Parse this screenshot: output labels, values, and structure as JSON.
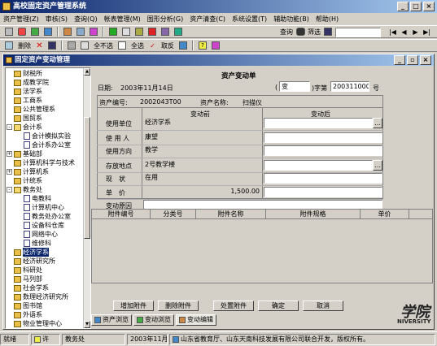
{
  "app": {
    "title": "高校固定资产管理系统"
  },
  "menu": [
    "资产管理(Z)",
    "审核(S)",
    "查询(Q)",
    "帐表管理(M)",
    "图形分析(G)",
    "资产清查(C)",
    "系统设置(T)",
    "辅助功能(B)",
    "帮助(H)"
  ],
  "toolbar2": {
    "delete": "删除",
    "select_none": "全不选",
    "select_all": "全选",
    "cancel_sel": "取反"
  },
  "toolbar1": {
    "query": "查询",
    "filter": "筛选",
    "search_placeholder": ""
  },
  "inner": {
    "title": "固定资产变动管理"
  },
  "tree": [
    {
      "label": "财税所",
      "level": 1,
      "icon": "folder"
    },
    {
      "label": "成教学院",
      "level": 1,
      "icon": "folder"
    },
    {
      "label": "法学系",
      "level": 1,
      "icon": "folder"
    },
    {
      "label": "工商系",
      "level": 1,
      "icon": "folder"
    },
    {
      "label": "公共管理系",
      "level": 1,
      "icon": "folder"
    },
    {
      "label": "国贸系",
      "level": 1,
      "icon": "folder"
    },
    {
      "label": "会计系",
      "level": 1,
      "icon": "folder-open",
      "pm": "-"
    },
    {
      "label": "会计模拟实验",
      "level": 2,
      "icon": "doc"
    },
    {
      "label": "会计系办公室",
      "level": 2,
      "icon": "doc"
    },
    {
      "label": "基础部",
      "level": 1,
      "icon": "folder",
      "pm": "+"
    },
    {
      "label": "计算机科学与技术",
      "level": 1,
      "icon": "folder"
    },
    {
      "label": "计算机系",
      "level": 1,
      "icon": "folder",
      "pm": "+"
    },
    {
      "label": "计统系",
      "level": 1,
      "icon": "folder"
    },
    {
      "label": "教务处",
      "level": 1,
      "icon": "folder-open",
      "pm": "-"
    },
    {
      "label": "电教科",
      "level": 2,
      "icon": "doc"
    },
    {
      "label": "计算机中心",
      "level": 2,
      "icon": "doc"
    },
    {
      "label": "教务处办公室",
      "level": 2,
      "icon": "doc"
    },
    {
      "label": "设备科仓库",
      "level": 2,
      "icon": "doc"
    },
    {
      "label": "网络中心",
      "level": 2,
      "icon": "doc"
    },
    {
      "label": "维修科",
      "level": 2,
      "icon": "doc"
    },
    {
      "label": "经济学系",
      "level": 1,
      "icon": "folder",
      "selected": true
    },
    {
      "label": "经济研究所",
      "level": 1,
      "icon": "folder"
    },
    {
      "label": "科研处",
      "level": 1,
      "icon": "folder"
    },
    {
      "label": "马列部",
      "level": 1,
      "icon": "folder"
    },
    {
      "label": "社会学系",
      "level": 1,
      "icon": "folder"
    },
    {
      "label": "数理经济研究所",
      "level": 1,
      "icon": "folder"
    },
    {
      "label": "图书馆",
      "level": 1,
      "icon": "folder"
    },
    {
      "label": "外语系",
      "level": 1,
      "icon": "folder"
    },
    {
      "label": "物业管理中心",
      "level": 1,
      "icon": "folder"
    }
  ],
  "form": {
    "doc_title": "资产变动单",
    "date_label": "日期:",
    "date_value": "2003年11月14日",
    "word_value": "变",
    "word_label": ")字第",
    "number_value": "2003110002",
    "number_suffix": "号",
    "asset_no_label": "资产编号:",
    "asset_no": "2002043T00",
    "asset_name_label": "资产名称:",
    "asset_name": "扫描仪",
    "before_header": "变动前",
    "after_header": "变动后",
    "rows": [
      {
        "label": "使用单位",
        "before": "经济学系"
      },
      {
        "label": "使 用 人",
        "before": "康望"
      },
      {
        "label": "使用方向",
        "before": "教学"
      },
      {
        "label": "存放地点",
        "before": "2号教学楼"
      },
      {
        "label": "现　状",
        "before": "在用"
      },
      {
        "label": "单　价",
        "before": "1,500.00"
      },
      {
        "label": "变动原因",
        "before": ""
      }
    ]
  },
  "grid": {
    "columns": [
      "附件编号",
      "分类号",
      "附件名称",
      "附件规格",
      "单价"
    ]
  },
  "buttons": {
    "add": "增加附件",
    "delete": "删除附件",
    "handle": "处置附件",
    "ok": "确定",
    "cancel": "取消"
  },
  "tabs": [
    "资产浏览",
    "变动浏览",
    "变动编辑"
  ],
  "status": {
    "ready": "就绪",
    "perm": "许",
    "dept": "教务处",
    "date": "2003年11月1",
    "copyright": "山东省教育厅、山东天南科技发展有限公司联合开发，版权所有。"
  },
  "brand": {
    "text": "学院",
    "sub": "NIVERSITY"
  }
}
